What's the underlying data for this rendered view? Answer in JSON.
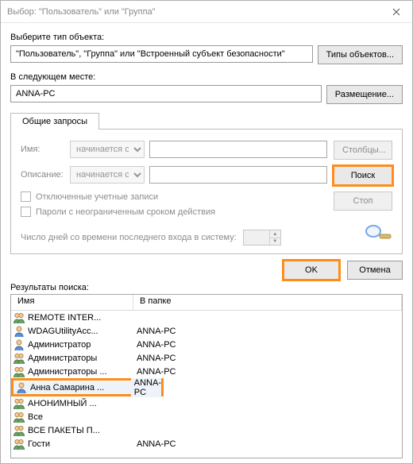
{
  "window": {
    "title": "Выбор: \"Пользователь\" или \"Группа\""
  },
  "section": {
    "object_type_label": "Выберите тип объекта:",
    "object_type_value": "\"Пользователь\", \"Группа\" или \"Встроенный субъект безопасности\"",
    "object_types_btn": "Типы объектов...",
    "location_label": "В следующем месте:",
    "location_value": "ANNA-PC",
    "locations_btn": "Размещение..."
  },
  "tabs": {
    "common_queries": "Общие запросы"
  },
  "query": {
    "name_label": "Имя:",
    "name_match": "начинается с",
    "description_label": "Описание:",
    "description_match": "начинается с",
    "chk_disabled": "Отключенные учетные записи",
    "chk_pwd_noexpire": "Пароли с неограниченным сроком действия",
    "days_label": "Число дней со времени последнего входа в систему:"
  },
  "side": {
    "columns_btn": "Столбцы...",
    "find_btn": "Поиск",
    "stop_btn": "Стоп"
  },
  "actions": {
    "ok": "OK",
    "cancel": "Отмена"
  },
  "results": {
    "label": "Результаты поиска:",
    "col_name": "Имя",
    "col_folder": "В папке",
    "rows": [
      {
        "icon": "group",
        "name": "REMOTE INTER...",
        "folder": "",
        "selected": false
      },
      {
        "icon": "user",
        "name": "WDAGUtilityAcc...",
        "folder": "ANNA-PC",
        "selected": false
      },
      {
        "icon": "user",
        "name": "Администратор",
        "folder": "ANNA-PC",
        "selected": false
      },
      {
        "icon": "group",
        "name": "Администраторы",
        "folder": "ANNA-PC",
        "selected": false
      },
      {
        "icon": "group",
        "name": "Администраторы ...",
        "folder": "ANNA-PC",
        "selected": false
      },
      {
        "icon": "user",
        "name": "Анна Самарина ...",
        "folder": "ANNA-PC",
        "selected": true
      },
      {
        "icon": "group",
        "name": "АНОНИМНЫЙ ...",
        "folder": "",
        "selected": false
      },
      {
        "icon": "group",
        "name": "Все",
        "folder": "",
        "selected": false
      },
      {
        "icon": "group",
        "name": "ВСЕ ПАКЕТЫ П...",
        "folder": "",
        "selected": false
      },
      {
        "icon": "group",
        "name": "Гости",
        "folder": "ANNA-PC",
        "selected": false
      }
    ]
  }
}
